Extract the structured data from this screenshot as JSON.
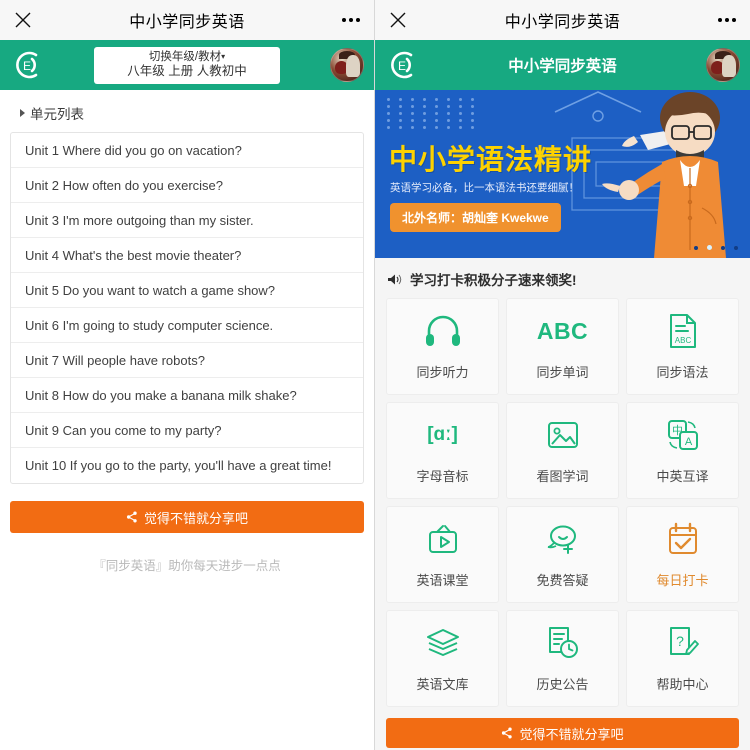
{
  "left": {
    "navbar": {
      "title": "中小学同步英语",
      "close_icon": "close-icon",
      "more_icon": "more-options-icon"
    },
    "header": {
      "logo_letter": "E",
      "grade_switch_label": "切换年级/教材",
      "caret": "▾",
      "grade_value": "八年级 上册 人教初中"
    },
    "unit_section_title": "单元列表",
    "units": [
      "Unit 1 Where did you go on vacation?",
      "Unit 2 How often do you exercise?",
      "Unit 3 I'm more outgoing than my sister.",
      "Unit 4 What's the best movie theater?",
      "Unit 5 Do you want to watch a game show?",
      "Unit 6 I'm going to study computer science.",
      "Unit 7 Will people have robots?",
      "Unit 8 How do you make a banana milk shake?",
      "Unit 9 Can you come to my party?",
      "Unit 10 If you go to the party, you'll have a great time!"
    ],
    "share_button": "觉得不错就分享吧",
    "footer_note": "『同步英语』助你每天进步一点点"
  },
  "right": {
    "navbar": {
      "title": "中小学同步英语",
      "close_icon": "close-icon",
      "more_icon": "more-options-icon"
    },
    "header": {
      "logo_letter": "E",
      "title": "中小学同步英语"
    },
    "banner": {
      "title": "中小学语法精讲",
      "subtitle": "英语学习必备，比一本语法书还要细腻！",
      "badge": "北外名师：胡灿奎 Kwekwe",
      "slide_count": 4,
      "active_slide": 2
    },
    "notice": "学习打卡积极分子速来领奖!",
    "grid": [
      {
        "label": "同步听力",
        "icon": "headphones-icon",
        "accent": false
      },
      {
        "label": "同步单词",
        "icon": "abc-text-icon",
        "accent": false
      },
      {
        "label": "同步语法",
        "icon": "document-abc-icon",
        "accent": false
      },
      {
        "label": "字母音标",
        "icon": "phonetic-bracket-icon",
        "accent": false
      },
      {
        "label": "看图学词",
        "icon": "image-picture-icon",
        "accent": false
      },
      {
        "label": "中英互译",
        "icon": "translate-icon",
        "accent": false
      },
      {
        "label": "英语课堂",
        "icon": "tv-play-icon",
        "accent": false
      },
      {
        "label": "免费答疑",
        "icon": "chat-plus-icon",
        "accent": false
      },
      {
        "label": "每日打卡",
        "icon": "calendar-check-icon",
        "accent": true
      },
      {
        "label": "英语文库",
        "icon": "layers-stack-icon",
        "accent": false
      },
      {
        "label": "历史公告",
        "icon": "document-clock-icon",
        "accent": false
      },
      {
        "label": "帮助中心",
        "icon": "question-pencil-icon",
        "accent": false
      }
    ],
    "share_button": "觉得不错就分享吧"
  },
  "colors": {
    "brand_green": "#17a981",
    "icon_green": "#1fb87e",
    "orange": "#f26c13",
    "accent_orange": "#e08a2e",
    "banner_blue": "#1d5fc4",
    "banner_yellow": "#fdd200"
  },
  "abc_label": "ABC",
  "ipa_label": "[ɑː]"
}
